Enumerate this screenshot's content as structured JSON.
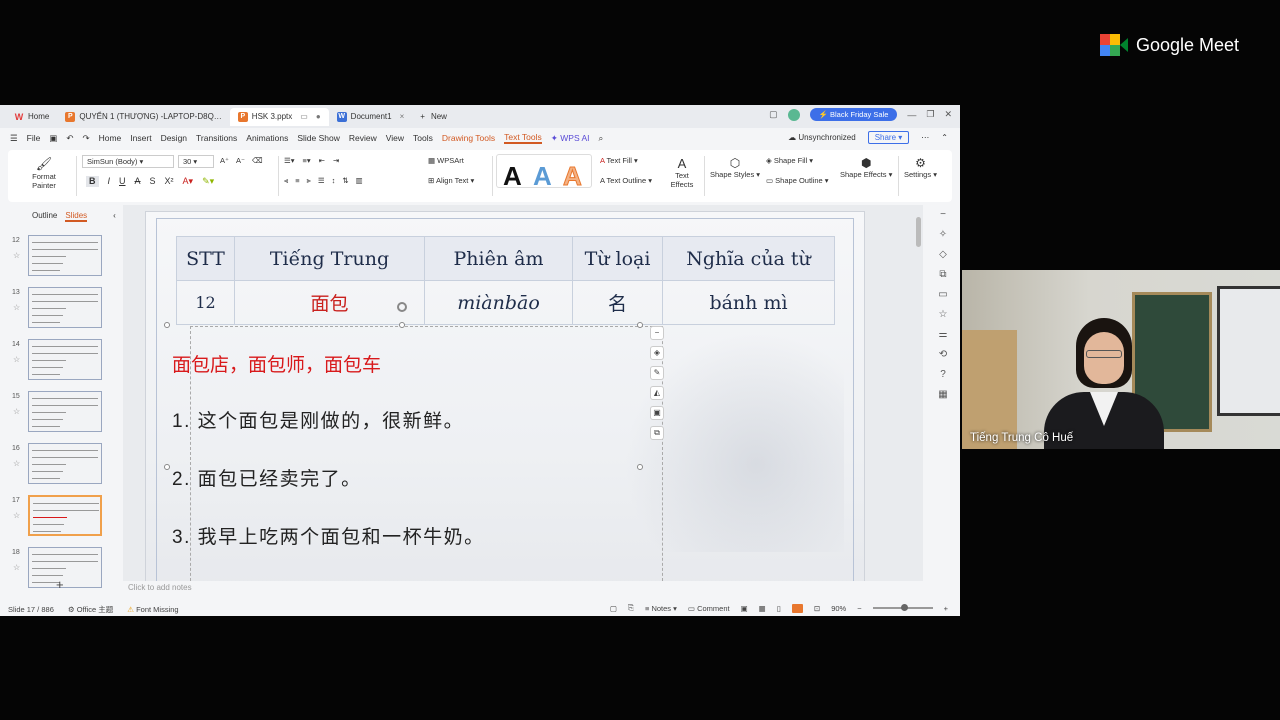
{
  "meet": {
    "brand": "Google Meet"
  },
  "tabs": [
    {
      "label": "Home",
      "icon": "W"
    },
    {
      "label": "QUYỂN 1 (THƯỢNG) -LAPTOP-D8Q…",
      "icon": "P"
    },
    {
      "label": "HSK 3.pptx",
      "icon": "P"
    },
    {
      "label": "Document1",
      "icon": "W"
    }
  ],
  "new_tab": "New",
  "promo": "Black Friday Sale",
  "menu": {
    "file": "File",
    "items": [
      "Home",
      "Insert",
      "Design",
      "Transitions",
      "Animations",
      "Slide Show",
      "Review",
      "View",
      "Tools"
    ],
    "drawing_tools": "Drawing Tools",
    "text_tools": "Text Tools",
    "wps_ai": "WPS AI",
    "sync": "Unsynchronized",
    "share": "Share"
  },
  "ribbon": {
    "format_painter": "Format Painter",
    "font_name": "SimSun (Body)",
    "font_size": "30",
    "wordart": "WPSArt",
    "align_text": "Align Text",
    "text_fill": "Text Fill",
    "text_outline": "Text Outline",
    "text_effects_1": "Text",
    "text_effects_2": "Effects",
    "shape_fill": "Shape Fill",
    "shape_outline": "Shape Outline",
    "shape_styles": "Shape Styles",
    "shape_effects": "Shape Effects",
    "settings": "Settings"
  },
  "left_panel": {
    "outline": "Outline",
    "slides": "Slides",
    "slide_numbers": [
      "12",
      "13",
      "14",
      "15",
      "16",
      "17",
      "18"
    ],
    "selected": "17"
  },
  "slide": {
    "table": {
      "headers": [
        "STT",
        "Tiếng Trung",
        "Phiên âm",
        "Từ loại",
        "Nghĩa của từ"
      ],
      "row": [
        "12",
        "面包",
        "miànbāo",
        "名",
        "bánh mì"
      ]
    },
    "phrases": "面包店，面包师，面包车",
    "sentences": [
      "1. 这个面包是刚做的，很新鲜。",
      "2. 面包已经卖完了。",
      "3. 我早上吃两个面包和一杯牛奶。"
    ]
  },
  "notes_placeholder": "Click to add notes",
  "status": {
    "slide_pos": "Slide 17 / 886",
    "theme": "Office 主题",
    "font_missing": "Font Missing",
    "notes": "Notes",
    "comment": "Comment",
    "zoom": "90%"
  },
  "participant": {
    "name": "Tiếng Trung Cô Huế"
  }
}
